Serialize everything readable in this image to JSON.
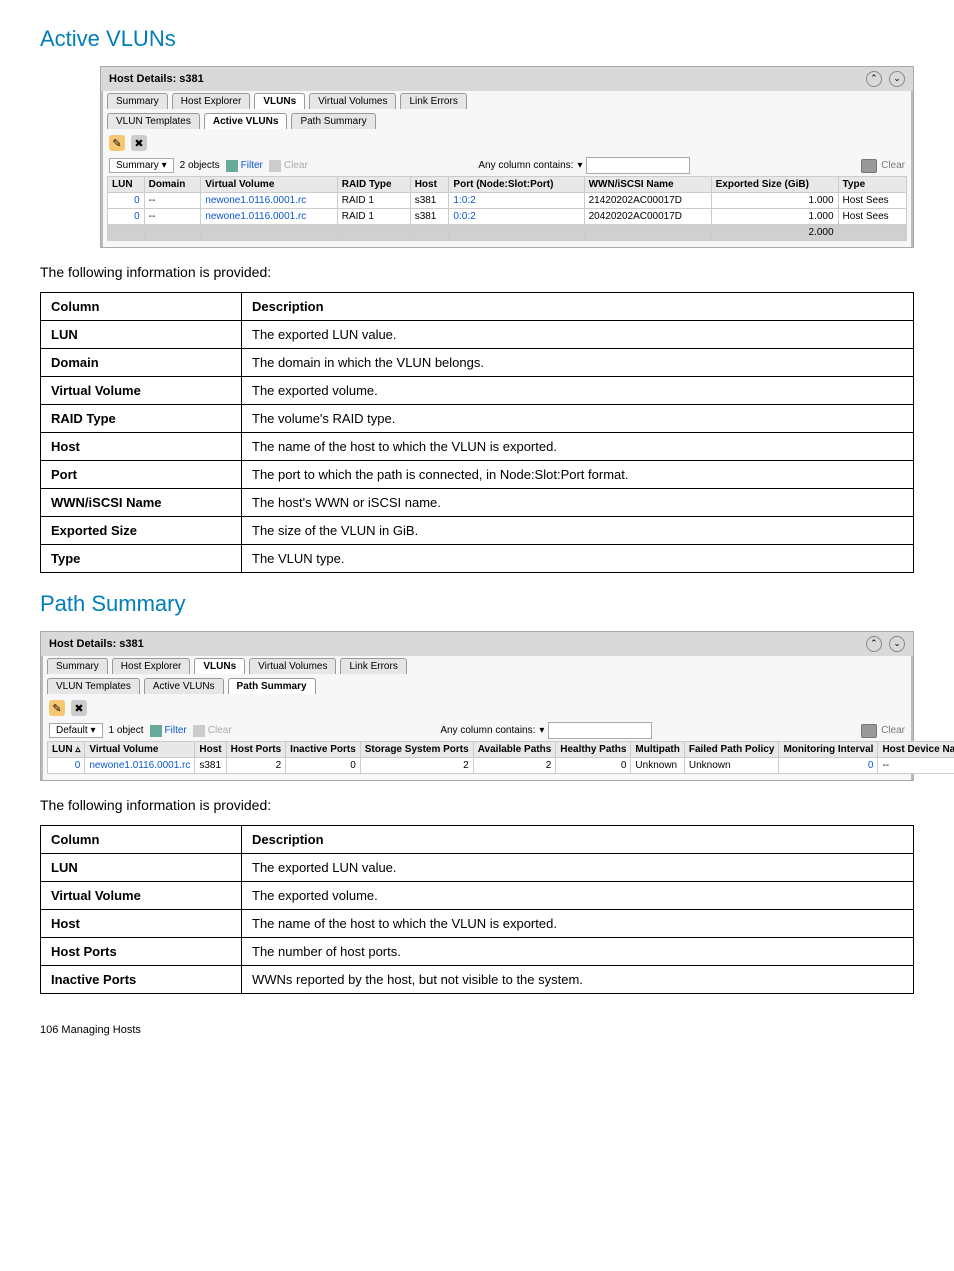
{
  "section1": {
    "title": "Active VLUNs",
    "panel": {
      "header": "Host Details: s381",
      "tabs_top": [
        "Summary",
        "Host Explorer",
        "VLUNs",
        "Virtual Volumes",
        "Link Errors"
      ],
      "tabs_top_active": "VLUNs",
      "tabs_sub": [
        "VLUN Templates",
        "Active VLUNs",
        "Path Summary"
      ],
      "tabs_sub_active": "Active VLUNs",
      "filter": {
        "dropdown": "Summary",
        "count_text": "2 objects",
        "filter_label": "Filter",
        "clear_label": "Clear",
        "any_col": "Any column contains:",
        "clear_right": "Clear"
      },
      "columns": [
        "LUN",
        "Domain",
        "Virtual Volume",
        "RAID Type",
        "Host",
        "Port (Node:Slot:Port)",
        "WWN/iSCSI Name",
        "Exported Size (GiB)",
        "Type"
      ],
      "rows": [
        {
          "lun": "0",
          "domain": "--",
          "vv": "newone1.0116.0001.rc",
          "raid": "RAID 1",
          "host": "s381",
          "port": "1:0:2",
          "wwn": "21420202AC00017D",
          "size": "1.000",
          "type": "Host Sees"
        },
        {
          "lun": "0",
          "domain": "--",
          "vv": "newone1.0116.0001.rc",
          "raid": "RAID 1",
          "host": "s381",
          "port": "0:0:2",
          "wwn": "20420202AC00017D",
          "size": "1.000",
          "type": "Host Sees"
        }
      ],
      "total_size": "2.000"
    },
    "intro": "The following information is provided:",
    "desc_header": {
      "c1": "Column",
      "c2": "Description"
    },
    "desc_rows": [
      {
        "c": "LUN",
        "d": "The exported LUN value."
      },
      {
        "c": "Domain",
        "d": "The domain in which the VLUN belongs."
      },
      {
        "c": "Virtual Volume",
        "d": "The exported volume."
      },
      {
        "c": "RAID Type",
        "d": "The volume's RAID type."
      },
      {
        "c": "Host",
        "d": "The name of the host to which the VLUN is exported."
      },
      {
        "c": "Port",
        "d": "The port to which the path is connected, in Node:Slot:Port format."
      },
      {
        "c": "WWN/iSCSI Name",
        "d": "The host's WWN or iSCSI name."
      },
      {
        "c": "Exported Size",
        "d": "The size of the VLUN in GiB."
      },
      {
        "c": "Type",
        "d": "The VLUN type."
      }
    ]
  },
  "section2": {
    "title": "Path Summary",
    "panel": {
      "header": "Host Details: s381",
      "tabs_top": [
        "Summary",
        "Host Explorer",
        "VLUNs",
        "Virtual Volumes",
        "Link Errors"
      ],
      "tabs_top_active": "VLUNs",
      "tabs_sub": [
        "VLUN Templates",
        "Active VLUNs",
        "Path Summary"
      ],
      "tabs_sub_active": "Path Summary",
      "filter": {
        "dropdown": "Default",
        "count_text": "1 object",
        "filter_label": "Filter",
        "clear_label": "Clear",
        "any_col": "Any column contains:",
        "clear_right": "Clear"
      },
      "columns": [
        "LUN ▵",
        "Virtual Volume",
        "Host",
        "Host Ports",
        "Inactive Ports",
        "Storage System Ports",
        "Available Paths",
        "Healthy Paths",
        "Multipath",
        "Failed Path Policy",
        "Monitoring Interval",
        "Host Device Name"
      ],
      "rows": [
        {
          "lun": "0",
          "vv": "newone1.0116.0001.rc",
          "host": "s381",
          "hp": "2",
          "ip": "0",
          "ssp": "2",
          "ap": "2",
          "hpth": "0",
          "mp": "Unknown",
          "fpp": "Unknown",
          "mi": "0",
          "hdn": "--"
        }
      ]
    },
    "intro": "The following information is provided:",
    "desc_header": {
      "c1": "Column",
      "c2": "Description"
    },
    "desc_rows": [
      {
        "c": "LUN",
        "d": "The exported LUN value."
      },
      {
        "c": "Virtual Volume",
        "d": "The exported volume."
      },
      {
        "c": "Host",
        "d": "The name of the host to which the VLUN is exported."
      },
      {
        "c": "Host Ports",
        "d": "The number of host ports."
      },
      {
        "c": "Inactive Ports",
        "d": "WWNs reported by the host, but not visible to the system."
      }
    ]
  },
  "footer": "106   Managing Hosts"
}
